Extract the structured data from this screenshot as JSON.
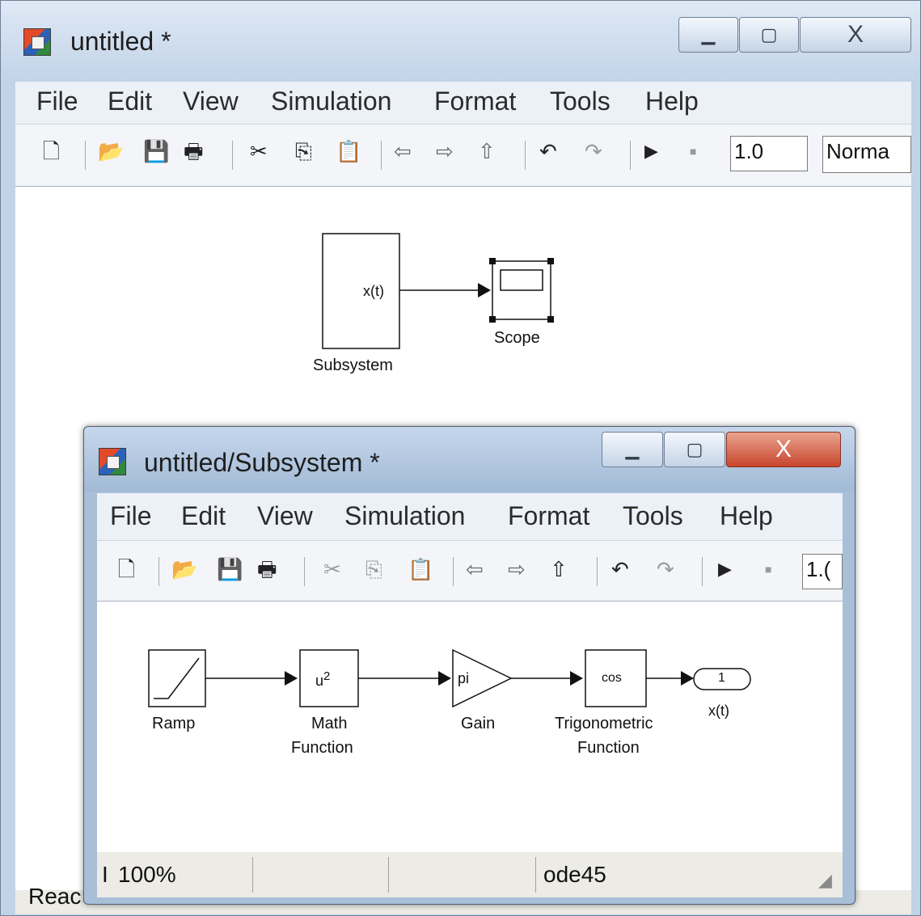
{
  "main_window": {
    "title": "untitled *",
    "menu": [
      "File",
      "Edit",
      "View",
      "Simulation",
      "Format",
      "Tools",
      "Help"
    ],
    "toolbar": {
      "icons": [
        "new-icon",
        "open-icon",
        "save-icon",
        "print-icon",
        "cut-icon",
        "copy-icon",
        "paste-icon",
        "back-icon",
        "forward-icon",
        "up-icon",
        "undo-icon",
        "redo-icon",
        "start-icon",
        "stop-icon"
      ],
      "stop_time": "1.0",
      "sim_mode": "Norma"
    },
    "blocks": {
      "subsystem": {
        "label": "Subsystem",
        "port": "x(t)"
      },
      "scope": {
        "label": "Scope"
      }
    },
    "status": "Reac"
  },
  "sub_window": {
    "title": "untitled/Subsystem *",
    "menu": [
      "File",
      "Edit",
      "View",
      "Simulation",
      "Format",
      "Tools",
      "Help"
    ],
    "toolbar": {
      "stop_time": "1.("
    },
    "blocks": {
      "ramp": {
        "label": "Ramp"
      },
      "math": {
        "text": "u",
        "exp": "2",
        "label1": "Math",
        "label2": "Function"
      },
      "gain": {
        "text": "pi",
        "label": "Gain"
      },
      "trig": {
        "text": "cos",
        "label1": "Trigonometric",
        "label2": "Function"
      },
      "outport": {
        "text": "1",
        "label": "x(t)"
      }
    },
    "status": {
      "left": "I",
      "zoom": "100%",
      "solver": "ode45"
    }
  }
}
